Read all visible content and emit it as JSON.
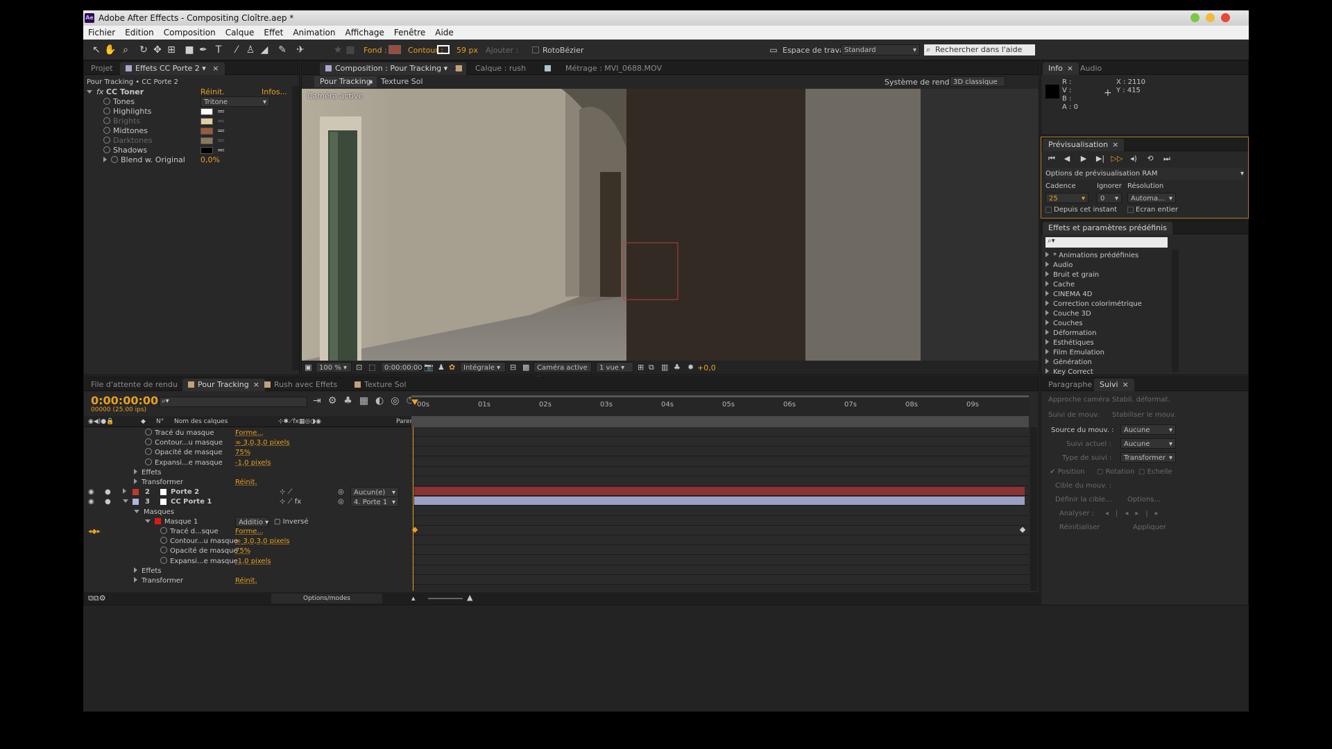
{
  "window": {
    "title": "Adobe After Effects - Compositing Cloître.aep *",
    "icon": "Ae"
  },
  "menu": [
    "Fichier",
    "Edition",
    "Composition",
    "Calque",
    "Effet",
    "Animation",
    "Affichage",
    "Fenêtre",
    "Aide"
  ],
  "toolbar": {
    "fond_label": "Fond :",
    "contour_label": "Contour :",
    "stroke_width": "59 px",
    "ajouter": "Ajouter :",
    "roto": "RotoBézier",
    "workspace_label": "Espace de travail :",
    "workspace_value": "Standard",
    "search_placeholder": "Rechercher dans l'aide"
  },
  "project_panel": {
    "tabs": [
      "Projet",
      "Effets CC Porte 2"
    ],
    "breadcrumb": "Pour Tracking • CC Porte 2",
    "effect": {
      "name": "CC Toner",
      "reset": "Réinit.",
      "about": "Infos...",
      "props": [
        {
          "name": "Tones",
          "value": "Tritone",
          "type": "dropdown"
        },
        {
          "name": "Highlights",
          "color": "#ffffff"
        },
        {
          "name": "Brights",
          "color": "#e2cfa4",
          "dim": true
        },
        {
          "name": "Midtones",
          "color": "#9c5a38"
        },
        {
          "name": "Darktones",
          "color": "#8a7a5a",
          "dim": true
        },
        {
          "name": "Shadows",
          "color": "#000000"
        },
        {
          "name": "Blend w. Original",
          "value": "0,0%",
          "type": "value"
        }
      ]
    }
  },
  "comp_panel": {
    "tabs": [
      "Composition : Pour Tracking",
      "Calque : rush",
      "Métrage : MVI_0688.MOV"
    ],
    "subtabs": [
      "Pour Tracking",
      "Texture Sol"
    ],
    "renderer_label": "Système de rendu :",
    "renderer_value": "3D classique",
    "camera_label": "Caméra active",
    "footer": {
      "zoom": "100 %",
      "time": "0:00:00:00",
      "resolution": "Intégrale",
      "camera": "Caméra active",
      "views": "1 vue",
      "exposure": "+0,0"
    }
  },
  "info_panel": {
    "tabs": [
      "Info",
      "Audio"
    ],
    "r": "R :",
    "v": "V :",
    "b": "B :",
    "a": "A : 0",
    "x": "X : 2110",
    "y": "Y : 415"
  },
  "preview_panel": {
    "tab": "Prévisualisation",
    "ram_options": "Options de prévisualisation RAM",
    "cadence_label": "Cadence",
    "ignorer_label": "Ignorer",
    "resolution_label": "Résolution",
    "cadence": "25",
    "ignorer": "0",
    "resolution": "Automa...",
    "depuis": "Depuis cet instant",
    "ecran": "Ecran entier"
  },
  "effects_presets": {
    "tab": "Effets et paramètres prédéfinis",
    "items": [
      "* Animations prédéfinies",
      "Audio",
      "Bruit et grain",
      "Cache",
      "CINEMA 4D",
      "Correction colorimétrique",
      "Couche 3D",
      "Couches",
      "Déformation",
      "Esthétiques",
      "Film Emulation",
      "Génération",
      "Key Correct"
    ]
  },
  "timeline": {
    "tabs": [
      "File d'attente de rendu",
      "Pour Tracking",
      "Rush avec Effets",
      "Texture Sol"
    ],
    "timecode": "0:00:00:00",
    "frames": "00000 (25.00 ips)",
    "col_num": "N°",
    "col_name": "Nom des calques",
    "col_parent": "Parent",
    "ruler": [
      "00s",
      "01s",
      "02s",
      "03s",
      "04s",
      "05s",
      "06s",
      "07s",
      "08s",
      "09s"
    ],
    "rows": [
      {
        "indent": 3,
        "label": "Tracé du masque",
        "value": "Forme...",
        "stopwatch": true
      },
      {
        "indent": 3,
        "label": "Contour...u masque",
        "value": "3,0,3,0 pixels",
        "stopwatch": true,
        "link": true
      },
      {
        "indent": 3,
        "label": "Opacité de masque",
        "value": "75%",
        "stopwatch": true
      },
      {
        "indent": 3,
        "label": "Expansi...e masque",
        "value": "-1,0 pixels",
        "stopwatch": true
      },
      {
        "indent": 2,
        "label": "Effets",
        "tri": "right"
      },
      {
        "indent": 2,
        "label": "Transformer",
        "value": "Réinit.",
        "tri": "right"
      },
      {
        "layer": true,
        "num": "2",
        "label": "Porte 2",
        "color": "#c0392b",
        "parent": "Aucun(e)",
        "tri": "right"
      },
      {
        "layer": true,
        "num": "3",
        "label": "CC Porte 1",
        "color": "#b0b4d8",
        "parent": "4. Porte 1",
        "tri": "down",
        "fx": true
      },
      {
        "indent": 2,
        "label": "Masques",
        "tri": "down"
      },
      {
        "indent": 3,
        "label": "Masque 1",
        "mode": "Additio",
        "inv": "Inversé",
        "tri": "down",
        "mask": true
      },
      {
        "indent": 4,
        "label": "Tracé d...sque",
        "value": "Forme...",
        "stopwatch": true,
        "kf": true
      },
      {
        "indent": 4,
        "label": "Contour...u masque",
        "value": "3,0,3,0 pixels",
        "stopwatch": true,
        "link": true
      },
      {
        "indent": 4,
        "label": "Opacité de masque",
        "value": "75%",
        "stopwatch": true
      },
      {
        "indent": 4,
        "label": "Expansi...e masque",
        "value": "-1,0 pixels",
        "stopwatch": true
      },
      {
        "indent": 2,
        "label": "Effets",
        "tri": "right"
      },
      {
        "indent": 2,
        "label": "Transformer",
        "value": "Réinit.",
        "tri": "right"
      }
    ],
    "options": "Options/modes"
  },
  "tracker_panel": {
    "tabs": [
      "Paragraphe",
      "Suivi"
    ],
    "approche": "Approche caméra",
    "stabil": "Stabil. déformat.",
    "suivi_mouv": "Suivi de mouv.",
    "stabiliser": "Stabiliser le mouv.",
    "source_label": "Source du mouv. :",
    "source_value": "Aucune",
    "suivi_actuel": "Suivi actuel :",
    "suivi_actuel_v": "Aucune",
    "type_label": "Type de suivi :",
    "type_value": "Transformer",
    "position": "Position",
    "rotation": "Rotation",
    "echelle": "Echelle",
    "cible": "Cible du mouv. :",
    "definir": "Définir la cible...",
    "options": "Options...",
    "analyser": "Analyser :",
    "reinit": "Réinitialiser",
    "appliquer": "Appliquer"
  },
  "colors": {
    "accent": "#e9a020",
    "layer2": "#8b3232",
    "layer3": "#9aa0c4"
  }
}
